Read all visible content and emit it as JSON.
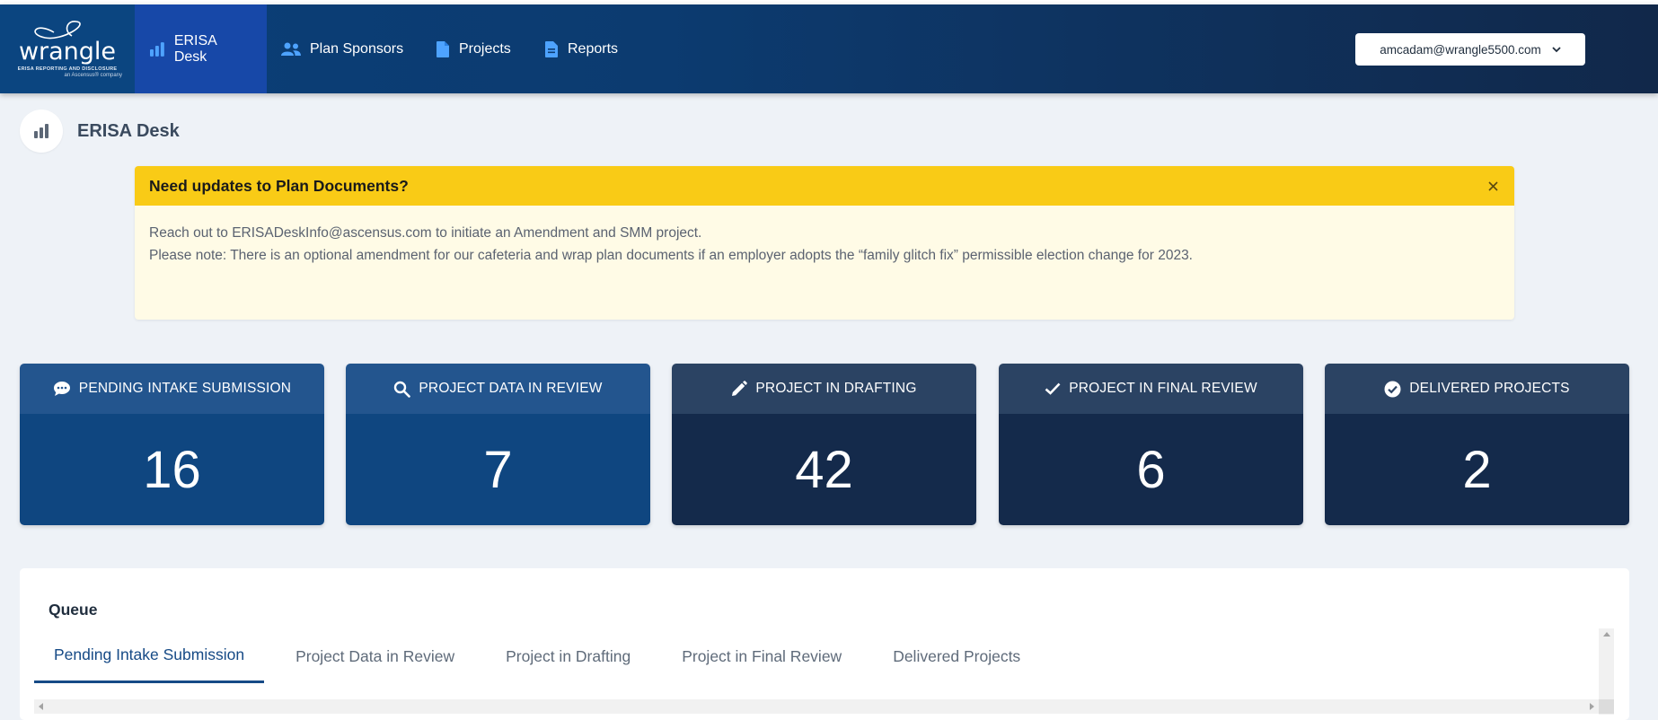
{
  "colors": {
    "nav_bg_start": "#0a3f78",
    "nav_bg_end": "#11284a",
    "nav_active": "#1748a8",
    "alert_header": "#f9cb16",
    "alert_body": "#fffbe6",
    "card_blue": "#0f4680",
    "card_navy": "#142a4b",
    "tab_active": "#164a86"
  },
  "logo": {
    "wordmark": "wrangle",
    "tagline": "ERISA REPORTING AND DISCLOSURE",
    "sub": "an Ascensus® company"
  },
  "nav": {
    "items": [
      {
        "label": "ERISA Desk",
        "icon": "bar-chart-icon",
        "active": true
      },
      {
        "label": "Plan Sponsors",
        "icon": "users-icon",
        "active": false
      },
      {
        "label": "Projects",
        "icon": "document-icon",
        "active": false
      },
      {
        "label": "Reports",
        "icon": "report-icon",
        "active": false
      }
    ],
    "user_email": "amcadam@wrangle5500.com"
  },
  "page": {
    "title": "ERISA Desk",
    "icon": "bar-chart-icon"
  },
  "alert": {
    "title": "Need updates to Plan Documents?",
    "line1": "Reach out to ERISADeskInfo@ascensus.com to initiate an Amendment and SMM project.",
    "line2": "Please note: There is an optional amendment for our cafeteria and wrap plan documents if an employer adopts the “family glitch fix” permissible election change for 2023."
  },
  "cards": [
    {
      "label": "PENDING INTAKE SUBMISSION",
      "value": "16",
      "icon": "chat-bubble-icon"
    },
    {
      "label": "PROJECT DATA IN REVIEW",
      "value": "7",
      "icon": "search-icon"
    },
    {
      "label": "PROJECT IN DRAFTING",
      "value": "42",
      "icon": "pencil-icon"
    },
    {
      "label": "PROJECT IN FINAL REVIEW",
      "value": "6",
      "icon": "check-icon"
    },
    {
      "label": "DELIVERED PROJECTS",
      "value": "2",
      "icon": "check-circle-icon"
    }
  ],
  "queue": {
    "title": "Queue",
    "tabs": [
      {
        "label": "Pending Intake Submission",
        "active": true
      },
      {
        "label": "Project Data in Review",
        "active": false
      },
      {
        "label": "Project in Drafting",
        "active": false
      },
      {
        "label": "Project in Final Review",
        "active": false
      },
      {
        "label": "Delivered Projects",
        "active": false
      }
    ]
  }
}
